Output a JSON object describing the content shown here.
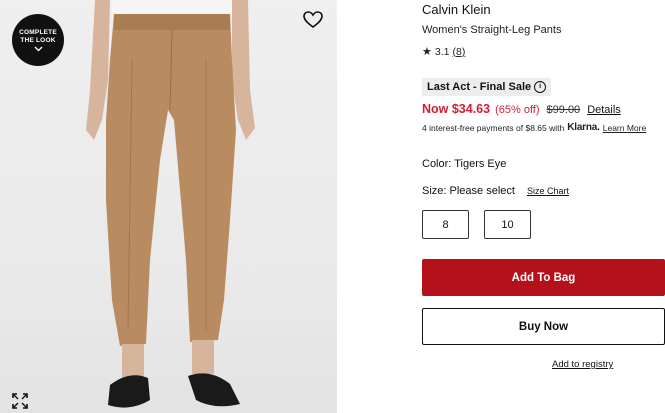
{
  "image": {
    "complete_look_line1": "COMPLETE",
    "complete_look_line2": "THE LOOK",
    "icons": [
      "chevron-down-icon",
      "heart-icon",
      "expand-icon"
    ]
  },
  "product": {
    "brand": "Calvin Klein",
    "name": "Women's Straight-Leg Pants",
    "rating_value": "3.1",
    "rating_count": "(8)"
  },
  "pricing": {
    "sale_badge": "Last Act - Final Sale",
    "now_price": "Now $34.63",
    "discount": "(65% off)",
    "original_price": "$99.00",
    "details_link": "Details",
    "installments_text": "4 interest-free payments of $8.65 with",
    "klarna": "Klarna.",
    "learn_more": "Learn More"
  },
  "options": {
    "color_label": "Color: Tigers Eye",
    "size_label": "Size: Please select",
    "size_chart": "Size Chart",
    "sizes": [
      "8",
      "10"
    ]
  },
  "actions": {
    "add_to_bag": "Add To Bag",
    "buy_now": "Buy Now",
    "add_to_registry": "Add to registry"
  },
  "colors": {
    "sale_red": "#d12035",
    "add_to_bag_bg": "#b5111a"
  }
}
